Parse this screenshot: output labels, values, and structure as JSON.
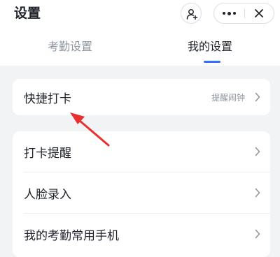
{
  "header": {
    "title": "设置",
    "icons": [
      "add-user-icon",
      "more-icon",
      "close-icon"
    ]
  },
  "tabs": [
    {
      "label": "考勤设置",
      "active": false
    },
    {
      "label": "我的设置",
      "active": true
    }
  ],
  "quick_card": {
    "label": "快捷打卡",
    "sub": "提醒闹钟"
  },
  "settings_list": [
    {
      "label": "打卡提醒"
    },
    {
      "label": "人脸录入"
    },
    {
      "label": "我的考勤常用手机"
    }
  ],
  "colors": {
    "accent": "#3370ff",
    "annotation_arrow": "#e8312f",
    "background": "#f2f3f5"
  }
}
